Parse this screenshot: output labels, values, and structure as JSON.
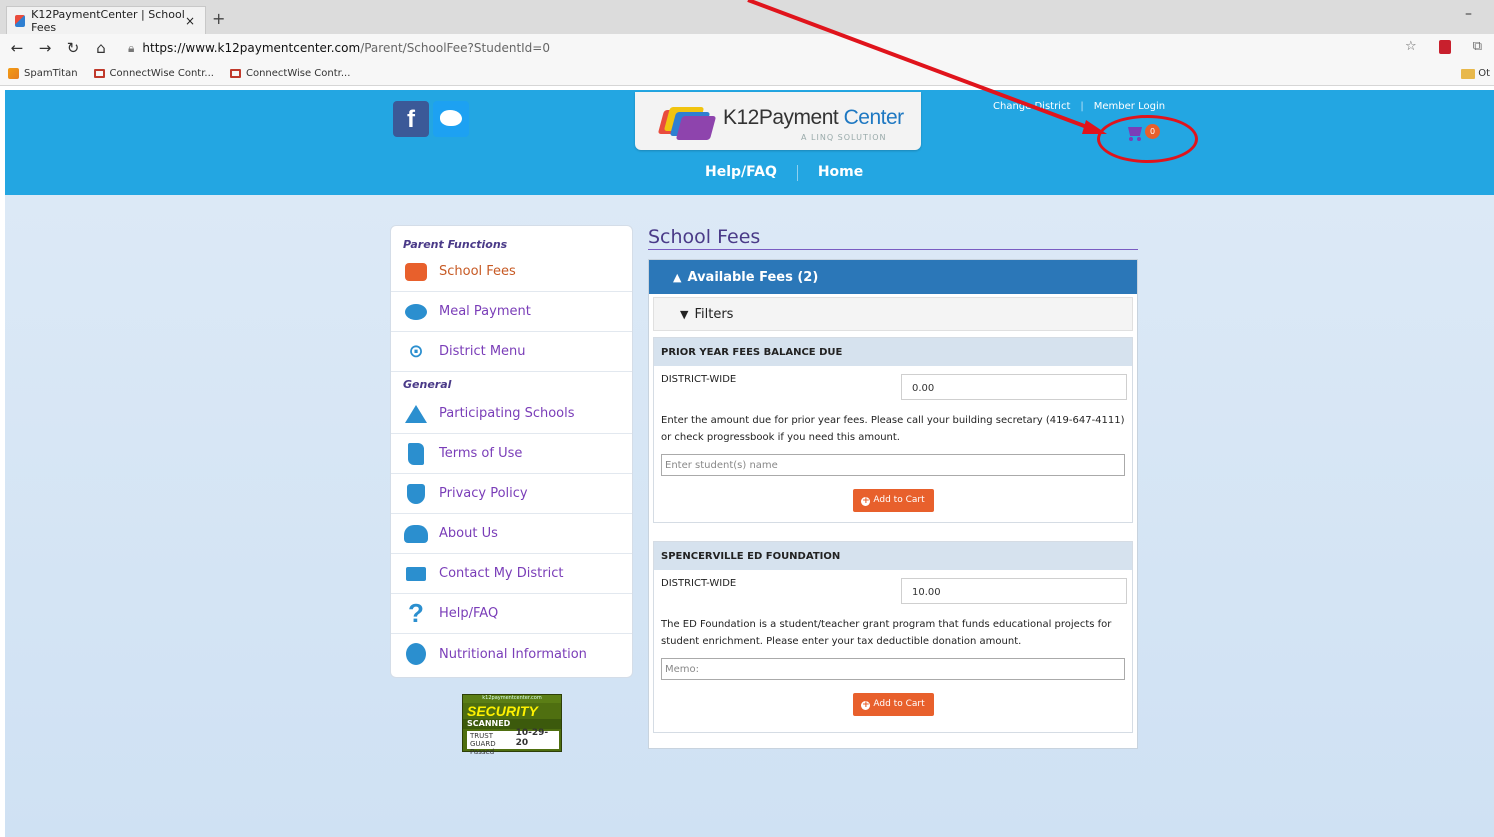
{
  "browser": {
    "tab_title": "K12PaymentCenter | School Fees",
    "tab_close": "×",
    "new_tab": "+",
    "minimize": "–",
    "url_host": "https://www.k12paymentcenter.com",
    "url_path": "/Parent/SchoolFee?StudentId=0",
    "bookmarks": [
      "SpamTitan",
      "ConnectWise Contr...",
      "ConnectWise Contr..."
    ],
    "other_bookmarks": "Ot"
  },
  "header": {
    "facebook": "f",
    "logo_text_a": "K12",
    "logo_text_b": "Payment",
    "logo_text_c": "Center",
    "logo_sub": "A LINQ SOLUTION",
    "link_change_district": "Change District",
    "link_member_login": "Member Login",
    "cart_count": "0",
    "menu": [
      "Help/FAQ",
      "Home"
    ]
  },
  "sidebar": {
    "section_parent": "Parent Functions",
    "section_general": "General",
    "items": [
      {
        "label": "School Fees",
        "icon": "bus-icon"
      },
      {
        "label": "Meal Payment",
        "icon": "piggy-bank-icon"
      },
      {
        "label": "District Menu",
        "icon": "plate-icon"
      },
      {
        "label": "Participating Schools",
        "icon": "school-icon"
      },
      {
        "label": "Terms of Use",
        "icon": "scroll-icon"
      },
      {
        "label": "Privacy Policy",
        "icon": "shield-icon"
      },
      {
        "label": "About Us",
        "icon": "people-icon"
      },
      {
        "label": "Contact My District",
        "icon": "mail-icon"
      },
      {
        "label": "Help/FAQ",
        "icon": "question-icon"
      },
      {
        "label": "Nutritional Information",
        "icon": "apple-icon"
      }
    ],
    "trust_top": "k12paymentcenter.com",
    "trust_security": "SECURITY",
    "trust_scanned": "SCANNED",
    "trust_guard": "TRUST GUARD",
    "trust_passed": "Passed",
    "trust_date": "10-29-20"
  },
  "main": {
    "title": "School Fees",
    "panel_header": "Available Fees (2)",
    "filters_label": "Filters",
    "fees": [
      {
        "name": "PRIOR YEAR FEES BALANCE DUE",
        "scope": "DISTRICT-WIDE",
        "amount": "0.00",
        "description": "Enter the amount due for prior year fees. Please call your building secretary (419-647-4111) or check progressbook if you need this amount.",
        "input_placeholder": "Enter student(s) name",
        "button": "Add to Cart"
      },
      {
        "name": "SPENCERVILLE ED FOUNDATION",
        "scope": "DISTRICT-WIDE",
        "amount": "10.00",
        "description": "The ED Foundation is a student/teacher grant program that funds educational projects for student enrichment. Please enter your tax deductible donation amount.",
        "input_placeholder": "Memo:",
        "button": "Add to Cart"
      }
    ]
  },
  "colors": {
    "header_blue": "#23a6e2",
    "panel_blue": "#2b77b8",
    "accent_orange": "#e8602c",
    "purple": "#7a3db8",
    "annotation_red": "#e0141c"
  }
}
